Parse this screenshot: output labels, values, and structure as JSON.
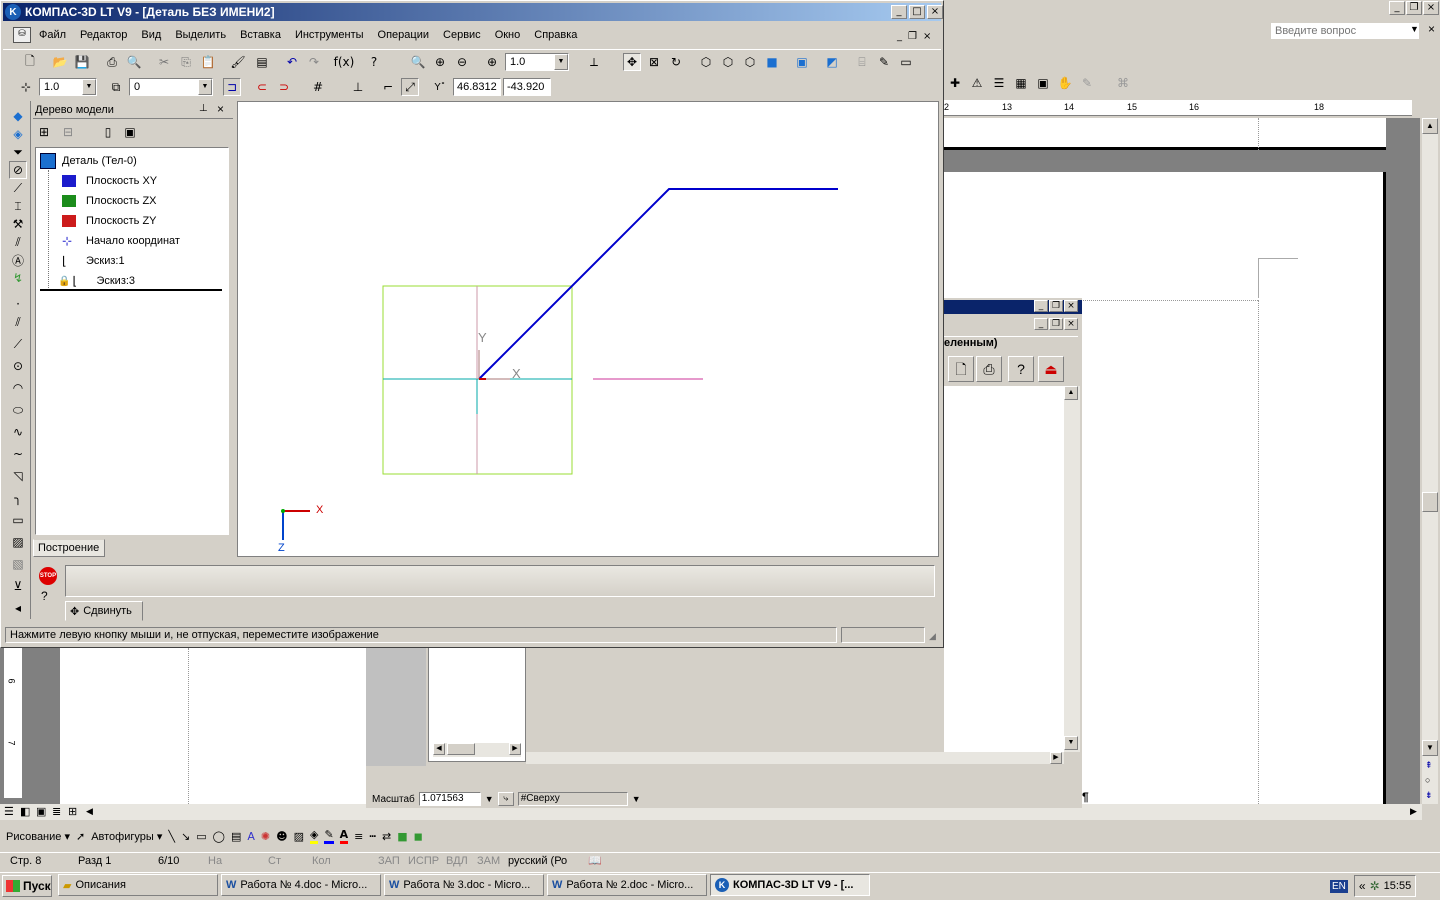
{
  "word": {
    "search_placeholder": "Введите вопрос",
    "ruler_numbers": [
      "2",
      "13",
      "14",
      "15",
      "16",
      "18"
    ],
    "status": [
      "Стр. 8",
      "Разд 1",
      "6/10",
      "На",
      "Ст",
      "Кол",
      "ЗАП",
      "ИСПР",
      "ВДЛ",
      "ЗАМ",
      "русский (Ро"
    ],
    "draw_toolbar": {
      "drawing": "Рисование",
      "autoshapes": "Автофигуры"
    },
    "vruler": [
      "6",
      "7"
    ]
  },
  "subwin": {
    "title_fragment": "еленным)",
    "scale_label": "Масштаб",
    "scale_value": "1.071563",
    "view_value": "#Сверху"
  },
  "kompas": {
    "title": "КОМПАС-3D LT V9 - [Деталь БЕЗ ИМЕНИ2]",
    "menu": [
      "Файл",
      "Редактор",
      "Вид",
      "Выделить",
      "Вставка",
      "Инструменты",
      "Операции",
      "Сервис",
      "Окно",
      "Справка"
    ],
    "zoom_value": "1.0",
    "step_value": "1.0",
    "layer_value": "0",
    "coord_x": "46.8312",
    "coord_y": "-43.920",
    "tree": {
      "title": "Дерево модели",
      "items": [
        "Деталь (Тел-0)",
        "Плоскость XY",
        "Плоскость ZX",
        "Плоскость ZY",
        "Начало координат",
        "Эскиз:1",
        "Эскиз:3"
      ],
      "tab": "Построение"
    },
    "axes": {
      "y": "Y",
      "x": "X",
      "triad_x": "X",
      "triad_z": "Z"
    },
    "move_button": "Сдвинуть",
    "status_text": "Нажмите левую кнопку мыши и, не отпуская, переместите изображение",
    "stop_label": "STOP"
  },
  "taskbar": {
    "start": "Пуск",
    "items": [
      "Описания",
      "Работа № 4.doc - Micro...",
      "Работа № 3.doc - Micro...",
      "Работа № 2.doc - Micro...",
      "КОМПАС-3D LT V9 - [..."
    ],
    "lang": "EN",
    "time": "15:55",
    "chevron": "«"
  },
  "colors": {
    "title_active": "#0a246a",
    "title_active_end": "#a6caf0",
    "sketch_line": "#0000cc",
    "plane_green": "#99dd33",
    "axis_cyan": "#00aaaa",
    "axis_pink": "#cc3399"
  }
}
